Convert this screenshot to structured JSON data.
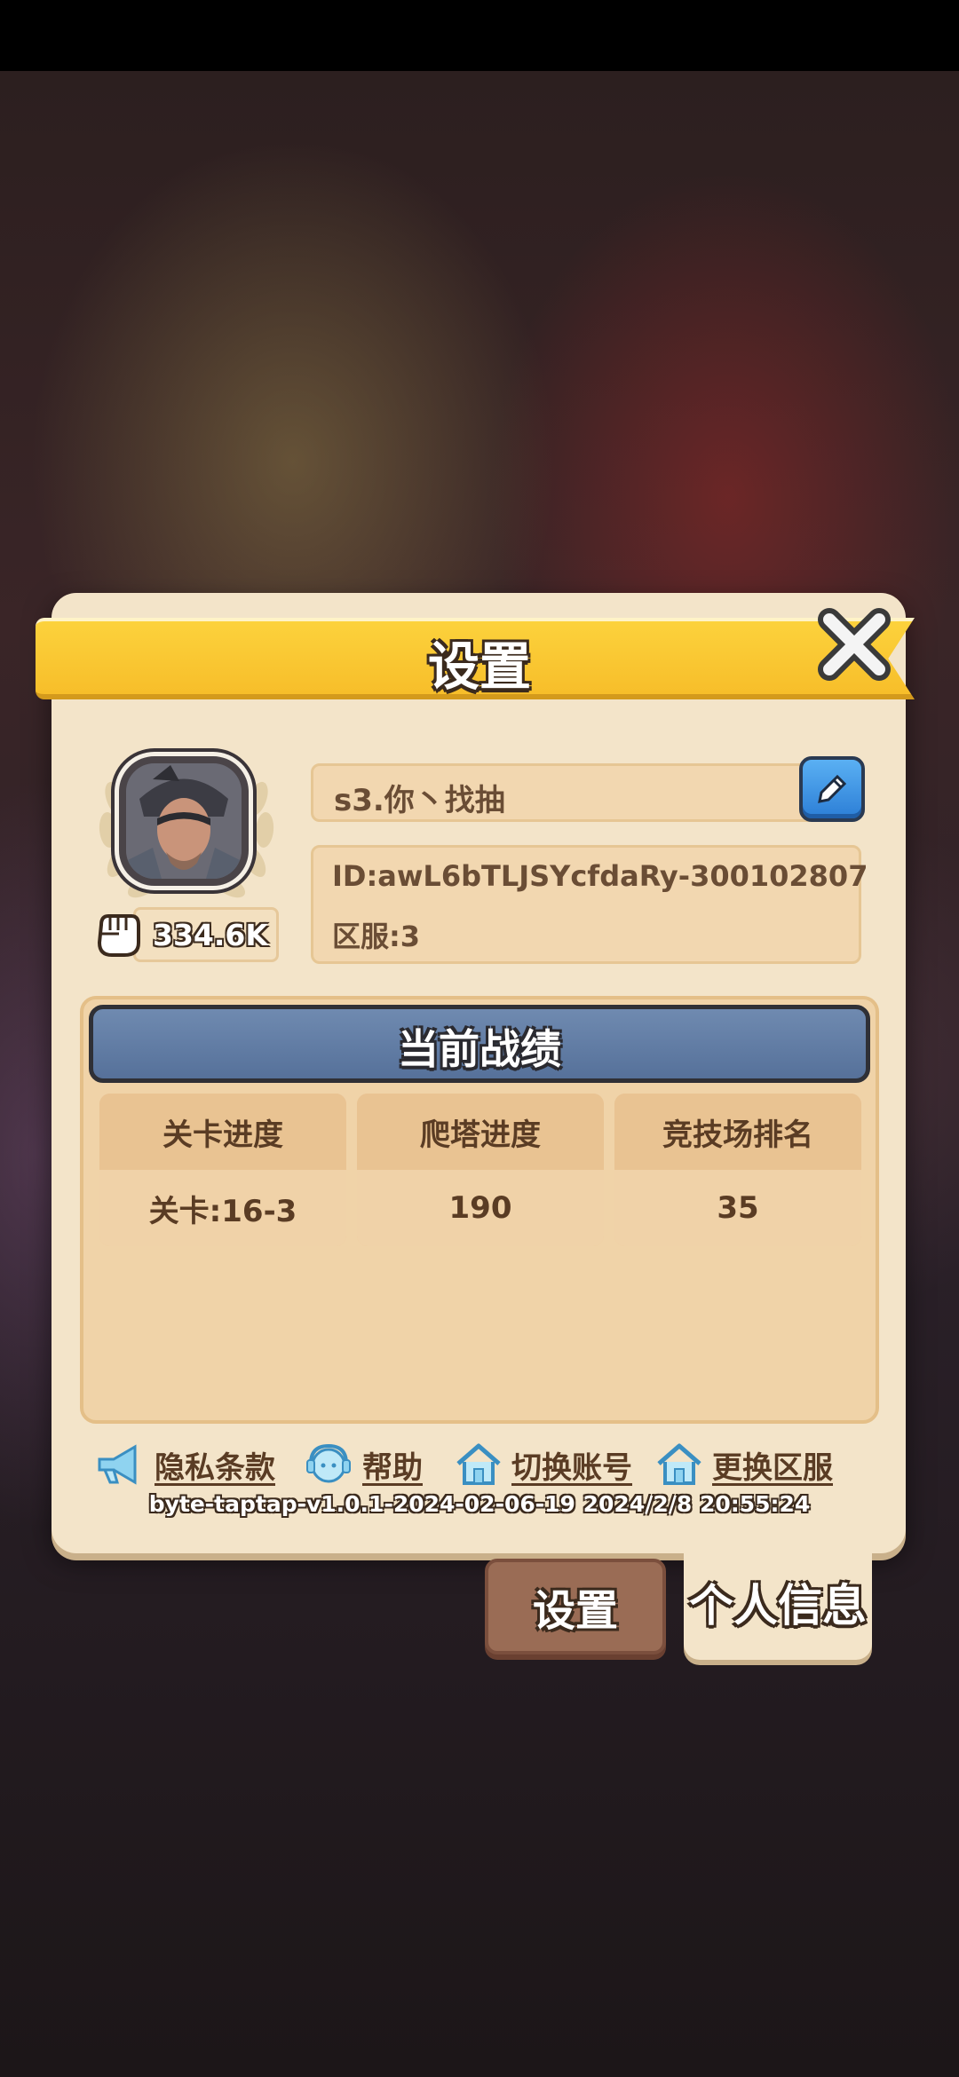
{
  "dialog": {
    "title": "设置"
  },
  "profile": {
    "name": "s3.你丶找抽",
    "id": "ID:awL6bTLJSYcfdaRy-300102807",
    "server": "区服:3",
    "power": "334.6K"
  },
  "stats": {
    "header": "当前战绩",
    "items": [
      {
        "label": "关卡进度",
        "value": "关卡:16-3"
      },
      {
        "label": "爬塔进度",
        "value": "190"
      },
      {
        "label": "竞技场排名",
        "value": "35"
      }
    ]
  },
  "links": {
    "privacy": "隐私条款",
    "help": "帮助",
    "switch_account": "切换账号",
    "change_server": "更换区服"
  },
  "version": "byte-taptap-v1.0.1-2024-02-06-19 2024/2/8 20:55:24",
  "tabs": {
    "settings": "设置",
    "profile": "个人信息"
  },
  "colors": {
    "ribbon": "#f7be2a",
    "panel": "#f3e4c9",
    "header": "#56719a",
    "edit_button": "#2c7ed6"
  }
}
